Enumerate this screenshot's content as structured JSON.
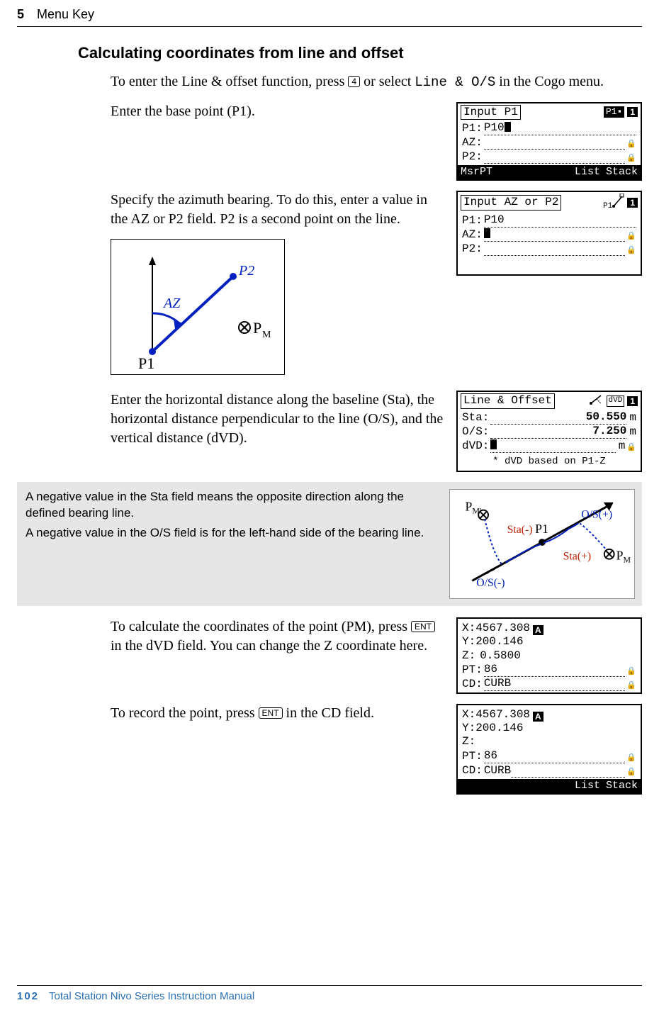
{
  "header": {
    "chapter_num": "5",
    "chapter_title": "Menu Key"
  },
  "section_title": "Calculating coordinates from line and offset",
  "intro": {
    "pre": "To enter the Line & offset function, press ",
    "key4": "4",
    "mid": " or select ",
    "mono": "Line & O/S",
    "post": " in the Cogo menu."
  },
  "step1_text": "Enter the base point (P1).",
  "step2_text": "Specify the azimuth bearing. To do this, enter a value in the AZ or P2 field. P2 is a second point on the line.",
  "step3_text": "Enter the horizontal distance along the baseline (Sta), the horizontal distance perpendicular to the line (O/S), and the vertical distance (dVD).",
  "callout_p1": "A negative value in the Sta field means the opposite direction along the defined bearing line.",
  "callout_p2": "A negative value in the O/S field is for the left-hand side of the bearing line.",
  "step4": {
    "pre": "To calculate the coordinates of the point (PM), press ",
    "key": "ENT",
    "post": " in the dVD field. You can change the Z coordinate here."
  },
  "step5": {
    "pre": "To record the point, press ",
    "key": "ENT",
    "post": " in the CD field."
  },
  "lcd1": {
    "title": "Input P1",
    "mini": "P1▪",
    "pg": "1",
    "p1_lbl": "P1:",
    "p1_val": "P10",
    "az_lbl": "AZ:",
    "p2_lbl": "P2:",
    "f1": "MsrPT",
    "f2": "List",
    "f3": "Stack"
  },
  "lcd2": {
    "title": "Input AZ or P2",
    "pg": "1",
    "p1_lbl": "P1:",
    "p1_val": "P10",
    "az_lbl": "AZ:",
    "p2_lbl": "P2:"
  },
  "lcd3": {
    "title": "Line & Offset",
    "dvd_tag": "dVD",
    "pg": "1",
    "sta_lbl": "Sta:",
    "sta_val": "50.550",
    "sta_unit": "m",
    "os_lbl": "O/S:",
    "os_val": "7.250",
    "os_unit": "m",
    "dvd_lbl": "dVD:",
    "dvd_unit": "m",
    "note": "* dVD based on P1-Z"
  },
  "lcd4": {
    "x_lbl": "X:",
    "x_val": "4567.308",
    "y_lbl": "Y:",
    "y_val": "200.146",
    "z_lbl": "Z:",
    "z_val": "0.5800",
    "pt_lbl": "PT:",
    "pt_val": "86",
    "cd_lbl": "CD:",
    "cd_val": "CURB",
    "A": "A"
  },
  "lcd5": {
    "x_lbl": "X:",
    "x_val": "4567.308",
    "y_lbl": "Y:",
    "y_val": "200.146",
    "z_lbl": "Z:",
    "pt_lbl": "PT:",
    "pt_val": "86",
    "cd_lbl": "CD:",
    "cd_val": "CURB",
    "A": "A",
    "f2": "List",
    "f3": "Stack"
  },
  "diagram1": {
    "AZ": "AZ",
    "P2": "P2",
    "PM": "P",
    "PMsub": "M",
    "P1": "P1"
  },
  "diagram2": {
    "PM1": "P",
    "PM1s": "M'",
    "Sta_neg": "Sta(-)",
    "Sta_pos": "Sta(+)",
    "OS_neg": "O/S(-)",
    "OS_pos": "O/S(+)",
    "P1": "P1",
    "PM2": "P",
    "PM2s": "M"
  },
  "lcd2_mini_p1": "P1",
  "footer": {
    "page": "102",
    "manual": "Total Station Nivo Series Instruction Manual"
  }
}
